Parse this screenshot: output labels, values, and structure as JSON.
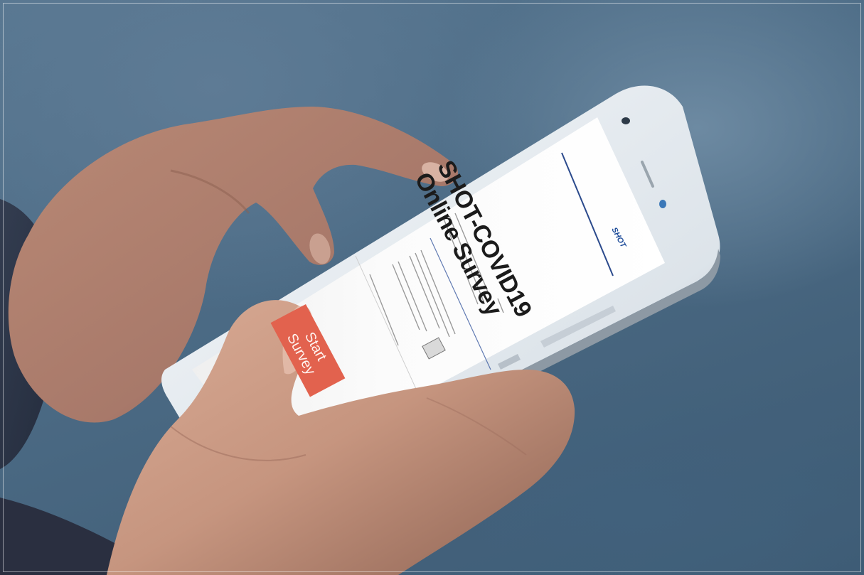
{
  "image": {
    "survey_title_line1": "SHOT-COVID19",
    "survey_title_line2": "Online Survey",
    "start_button_label": "Start Survey",
    "logo_text": "SHOT",
    "colors": {
      "background": "#4b6a84",
      "phone_body": "#e9eef3",
      "screen": "#fbfbfb",
      "button": "#e2624e",
      "accent_line": "#2b4a8c",
      "skin": "#c89a84"
    }
  }
}
